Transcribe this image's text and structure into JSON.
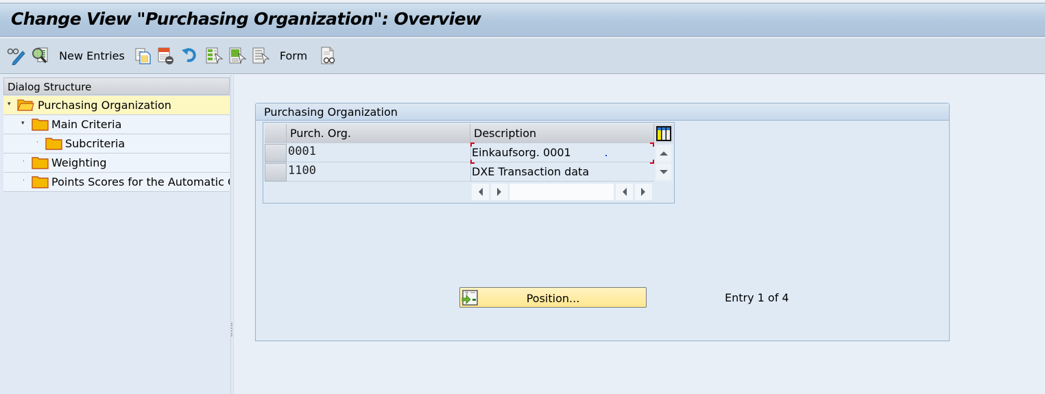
{
  "window": {
    "title": "Change View \"Purchasing Organization\": Overview"
  },
  "toolbar": {
    "items": [
      {
        "icon": "display-change-icon",
        "label": ""
      },
      {
        "icon": "find-icon",
        "label": ""
      },
      {
        "icon": "",
        "label": "New Entries"
      },
      {
        "icon": "copy-as-icon",
        "label": ""
      },
      {
        "icon": "delete-icon",
        "label": ""
      },
      {
        "icon": "undo-change-icon",
        "label": ""
      },
      {
        "icon": "select-all-icon",
        "label": ""
      },
      {
        "icon": "select-block-icon",
        "label": ""
      },
      {
        "icon": "deselect-all-icon",
        "label": ""
      },
      {
        "icon": "",
        "label": "Form"
      },
      {
        "icon": "print-preview-icon",
        "label": ""
      }
    ]
  },
  "dialog_structure": {
    "header": "Dialog Structure",
    "nodes": [
      {
        "label": "Purchasing Organization",
        "level": 0,
        "expanded": true,
        "selected": true,
        "folder": "open"
      },
      {
        "label": "Main Criteria",
        "level": 1,
        "expanded": true,
        "selected": false,
        "folder": "closed"
      },
      {
        "label": "Subcriteria",
        "level": 2,
        "expanded": false,
        "selected": false,
        "folder": "closed"
      },
      {
        "label": "Weighting",
        "level": 1,
        "expanded": false,
        "selected": false,
        "folder": "closed"
      },
      {
        "label": "Points Scores for the Automatic C",
        "level": 1,
        "expanded": false,
        "selected": false,
        "folder": "closed"
      }
    ]
  },
  "group": {
    "title": "Purchasing Organization",
    "table": {
      "columns": [
        "Purch. Org.",
        "Description"
      ],
      "rows": [
        {
          "org": "0001",
          "description": "Einkaufsorg. 0001",
          "focused": true
        },
        {
          "org": "1100",
          "description": "DXE Transaction data",
          "focused": false
        }
      ],
      "column_settings_icon": "table-settings-icon"
    },
    "position_button": "Position...",
    "entry_status": "Entry 1 of 4"
  },
  "colors": {
    "selected_node": "#fdf7c2",
    "focus_marker": "#d0021b",
    "folder": "#f5b800",
    "button_bg": "#ffe68f"
  }
}
